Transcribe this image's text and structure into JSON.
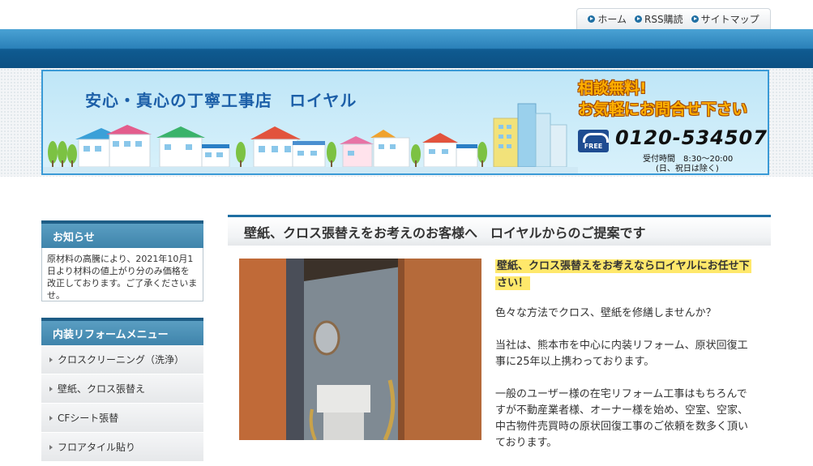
{
  "topnav": {
    "items": [
      {
        "label": "ホーム"
      },
      {
        "label": "RSS購読"
      },
      {
        "label": "サイトマップ"
      }
    ]
  },
  "banner": {
    "title": "安心・真心の丁寧工事店　ロイヤル",
    "cta_line1": "相談無料!",
    "cta_line2": "お気軽にお問合せ下さい",
    "free_label": "FREE",
    "phone": "0120-534507",
    "hours": "受付時間　8:30～20:00",
    "holiday": "(日、祝日は除く)"
  },
  "sidebar": {
    "notice_title": "お知らせ",
    "notice_text": "原材料の高騰により、2021年10月1日より材料の値上がり分のみ価格を改正しております。ご了承くださいませ。",
    "menu_title": "内装リフォームメニュー",
    "menu_items": [
      {
        "label": "クロスクリーニング（洗浄）"
      },
      {
        "label": "壁紙、クロス張替え"
      },
      {
        "label": "CFシート張替"
      },
      {
        "label": "フロアタイル貼り"
      }
    ]
  },
  "main": {
    "title": "壁紙、クロス張替えをお考えのお客様へ　ロイヤルからのご提案です",
    "highlight": "壁紙、クロス張替えをお考えならロイヤルにお任せ下さい！",
    "paragraphs": [
      "色々な方法でクロス、壁紙を修繕しませんか？",
      "当社は、熊本市を中心に内装リフォーム、原状回復工事に25年以上携わっております。",
      "一般のユーザー様の在宅リフォーム工事はもちろんですが不動産業者様、オーナー様を始め、空室、空家、中古物件売買時の原状回復工事のご依頼を数多く頂いております。"
    ]
  }
}
